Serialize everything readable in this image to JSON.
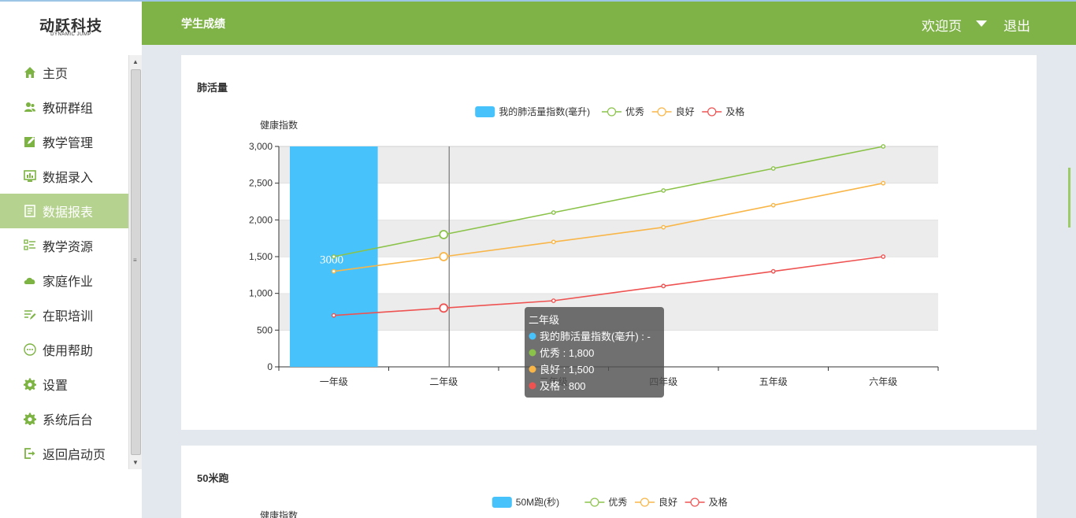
{
  "logo": {
    "name": "动跃科技",
    "subtitle": "DYNAMIC JUMP"
  },
  "sidebar": {
    "items": [
      {
        "label": "主页",
        "icon": "home-icon",
        "active": false
      },
      {
        "label": "教研群组",
        "icon": "users-icon",
        "active": false
      },
      {
        "label": "教学管理",
        "icon": "edit-icon",
        "active": false
      },
      {
        "label": "数据录入",
        "icon": "monitor-chart-icon",
        "active": false
      },
      {
        "label": "数据报表",
        "icon": "report-icon",
        "active": true
      },
      {
        "label": "教学资源",
        "icon": "list-icon",
        "active": false
      },
      {
        "label": "家庭作业",
        "icon": "cloud-icon",
        "active": false
      },
      {
        "label": "在职培训",
        "icon": "pen-list-icon",
        "active": false
      },
      {
        "label": "使用帮助",
        "icon": "chat-dots-icon",
        "active": false
      },
      {
        "label": "设置",
        "icon": "gear-icon",
        "active": false
      },
      {
        "label": "系统后台",
        "icon": "gear-icon",
        "active": false
      },
      {
        "label": "返回启动页",
        "icon": "exit-icon",
        "active": false
      }
    ]
  },
  "header": {
    "title": "学生成绩",
    "welcome": "欢迎页",
    "logout": "退出"
  },
  "colors": {
    "accent": "#7fb347",
    "active_menu": "#b5d28f",
    "bar": "#47c2fb",
    "excellent": "#8bc34a",
    "good": "#f9b648",
    "pass": "#ee5352"
  },
  "panels": {
    "lung": {
      "title": "肺活量"
    },
    "run": {
      "title": "50米跑"
    }
  },
  "chart_data": [
    {
      "type": "bar",
      "title": "肺活量",
      "ylabel": "健康指数",
      "ylim": [
        0,
        3000
      ],
      "yticks": [
        "0",
        "500",
        "1,000",
        "1,500",
        "2,000",
        "2,500",
        "3,000"
      ],
      "categories": [
        "一年级",
        "二年级",
        "三年级",
        "四年级",
        "五年级",
        "六年级"
      ],
      "legend_position": "top-center",
      "grid": true,
      "series": [
        {
          "name": "我的肺活量指数(毫升)",
          "type": "bar",
          "color": "#47c2fb",
          "values": [
            3000,
            null,
            null,
            null,
            null,
            null
          ],
          "label": "3000"
        },
        {
          "name": "优秀",
          "type": "line",
          "color": "#8bc34a",
          "values": [
            1500,
            1800,
            2100,
            2400,
            2700,
            3000
          ]
        },
        {
          "name": "良好",
          "type": "line",
          "color": "#f9b648",
          "values": [
            1300,
            1500,
            1700,
            1900,
            2200,
            2500
          ]
        },
        {
          "name": "及格",
          "type": "line",
          "color": "#ee5352",
          "values": [
            700,
            800,
            900,
            1100,
            1300,
            1500
          ]
        }
      ],
      "tooltip": {
        "title": "二年级",
        "rows": [
          {
            "text": "我的肺活量指数(毫升) : -",
            "color": "#47c2fb"
          },
          {
            "text": "优秀 : 1,800",
            "color": "#8bc34a"
          },
          {
            "text": "良好 : 1,500",
            "color": "#f9b648"
          },
          {
            "text": "及格 : 800",
            "color": "#ee5352"
          }
        ]
      }
    },
    {
      "type": "bar",
      "title": "50米跑",
      "ylabel": "健康指数",
      "legend_position": "top-center",
      "series": [
        {
          "name": "50M跑(秒)",
          "type": "bar",
          "color": "#47c2fb"
        },
        {
          "name": "优秀",
          "type": "line",
          "color": "#8bc34a"
        },
        {
          "name": "良好",
          "type": "line",
          "color": "#f9b648"
        },
        {
          "name": "及格",
          "type": "line",
          "color": "#ee5352"
        }
      ]
    }
  ]
}
